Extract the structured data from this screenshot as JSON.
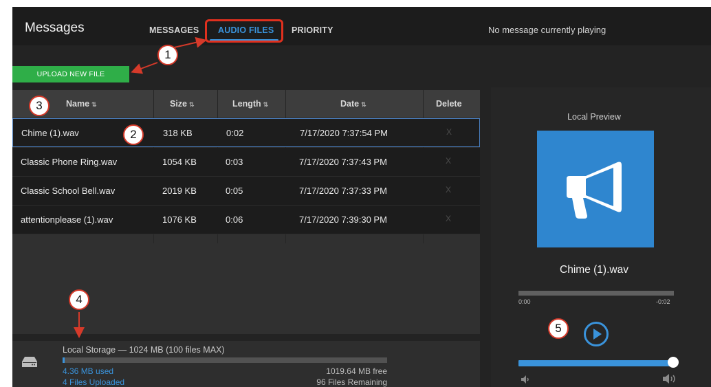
{
  "header": {
    "title": "Messages",
    "tabs": [
      {
        "label": "MESSAGES",
        "active": false
      },
      {
        "label": "AUDIO FILES",
        "active": true
      },
      {
        "label": "PRIORITY",
        "active": false
      }
    ],
    "now_playing": "No message currently playing"
  },
  "toolbar": {
    "upload_label": "UPLOAD NEW FILE"
  },
  "table": {
    "columns": [
      "Name",
      "Size",
      "Length",
      "Date",
      "Delete"
    ],
    "sort_glyph": "⇅",
    "rows": [
      {
        "name": "Chime (1).wav",
        "size": "318 KB",
        "length": "0:02",
        "date": "7/17/2020 7:37:54 PM",
        "delete": "X",
        "selected": true
      },
      {
        "name": "Classic Phone Ring.wav",
        "size": "1054 KB",
        "length": "0:03",
        "date": "7/17/2020 7:37:43 PM",
        "delete": "X",
        "selected": false
      },
      {
        "name": "Classic School Bell.wav",
        "size": "2019 KB",
        "length": "0:05",
        "date": "7/17/2020 7:37:33 PM",
        "delete": "X",
        "selected": false
      },
      {
        "name": "attentionplease (1).wav",
        "size": "1076 KB",
        "length": "0:06",
        "date": "7/17/2020 7:39:30 PM",
        "delete": "X",
        "selected": false
      }
    ]
  },
  "storage": {
    "title": "Local Storage — 1024 MB (100 files MAX)",
    "used": "4.36 MB used",
    "free": "1019.64 MB free",
    "files_uploaded": "4 Files Uploaded",
    "files_remaining": "96 Files Remaining",
    "used_fraction": 0.0043,
    "icon": "hard-drive-icon"
  },
  "preview": {
    "label": "Local Preview",
    "art_icon": "megaphone-icon",
    "file_name": "Chime (1).wav",
    "time_start": "0:00",
    "time_end": "-0:02",
    "playback_fraction": 0.0,
    "volume_fraction": 1.0,
    "play_icon": "play-circle-icon",
    "volume_low_icon": "volume-low-icon",
    "volume_high_icon": "volume-high-icon"
  },
  "annotations": [
    "1",
    "2",
    "3",
    "4",
    "5"
  ],
  "colors": {
    "accent": "#3a93db",
    "upload_green": "#2fae48",
    "annotation_red": "#d63a2a",
    "background": "#232323"
  }
}
